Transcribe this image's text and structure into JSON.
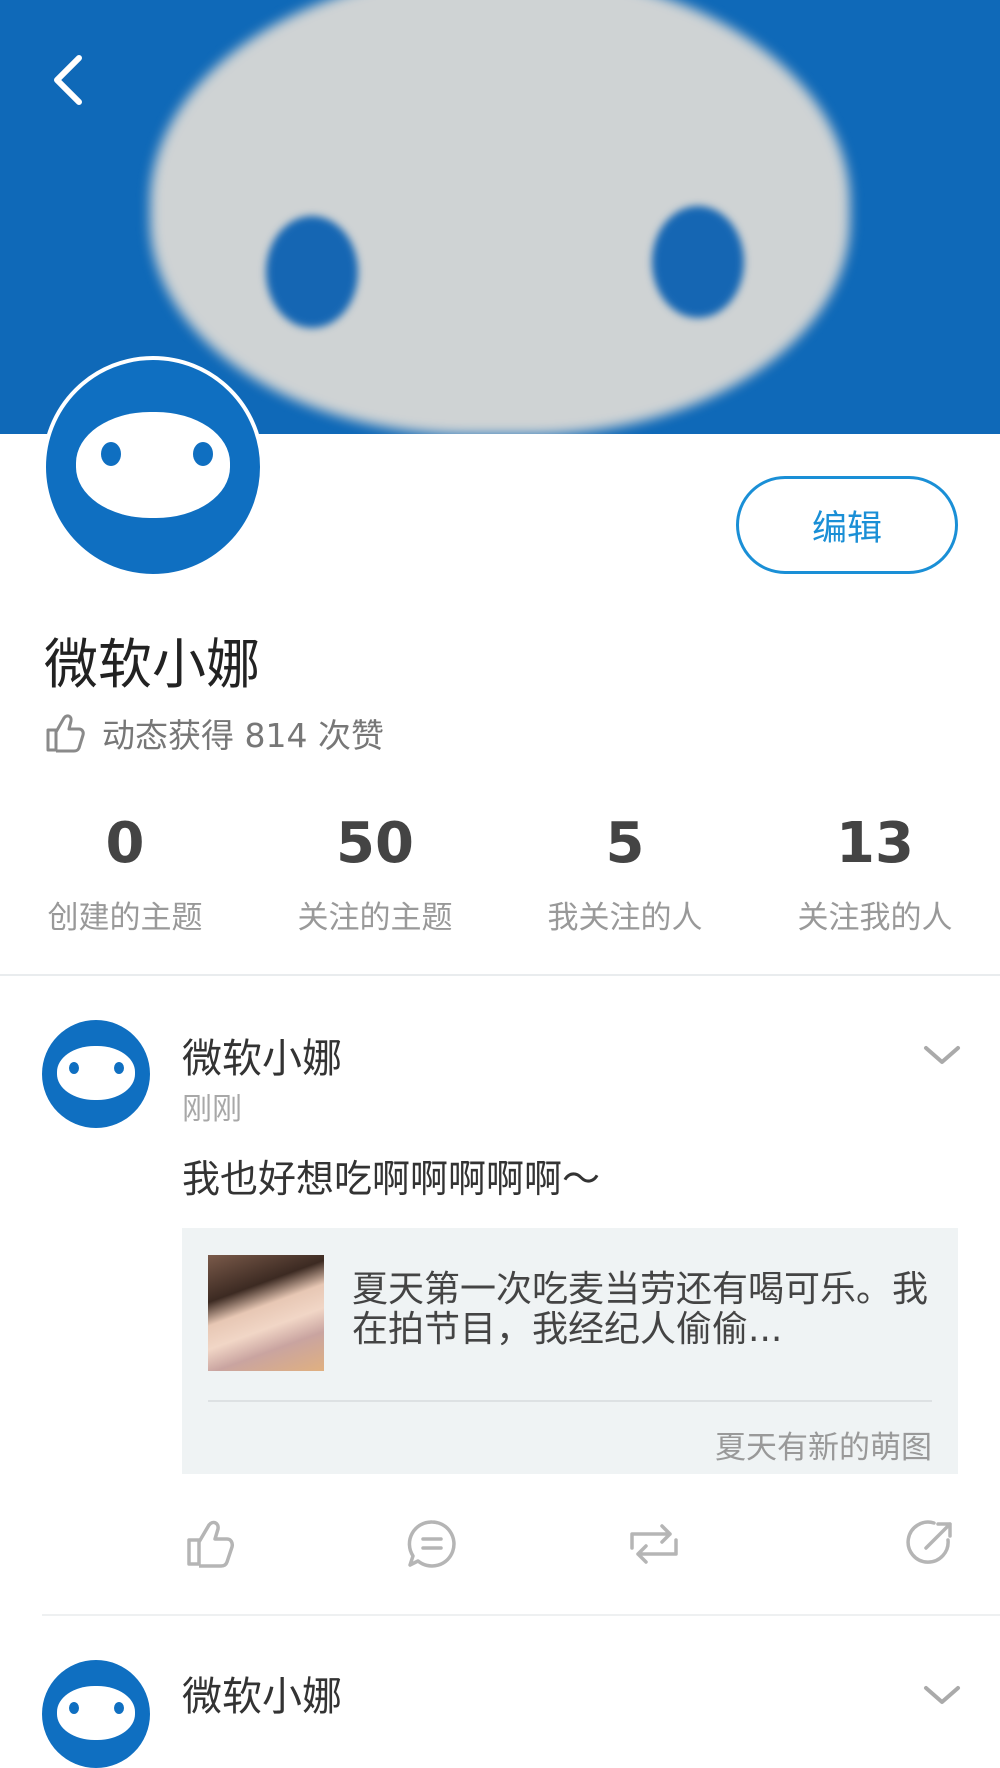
{
  "profile": {
    "name": "微软小娜",
    "likes_text": "动态获得 814 次赞",
    "edit_label": "编辑"
  },
  "stats": [
    {
      "value": "0",
      "label": "创建的主题"
    },
    {
      "value": "50",
      "label": "关注的主题"
    },
    {
      "value": "5",
      "label": "我关注的人"
    },
    {
      "value": "13",
      "label": "关注我的人"
    }
  ],
  "posts": [
    {
      "author": "微软小娜",
      "time": "刚刚",
      "text": "我也好想吃啊啊啊啊啊～",
      "quote": {
        "text": "夏天第一次吃麦当劳还有喝可乐。我在拍节目，我经纪人偷偷...",
        "source": "夏天有新的萌图"
      }
    },
    {
      "author": "微软小娜"
    }
  ],
  "colors": {
    "brand_blue": "#0f6fc1",
    "accent_blue": "#1a8fd6"
  },
  "icons": {
    "back": "chevron-left-icon",
    "like": "thumbs-up-icon",
    "comment": "comment-icon",
    "repost": "repost-icon",
    "share": "share-icon",
    "menu": "chevron-down-icon"
  }
}
